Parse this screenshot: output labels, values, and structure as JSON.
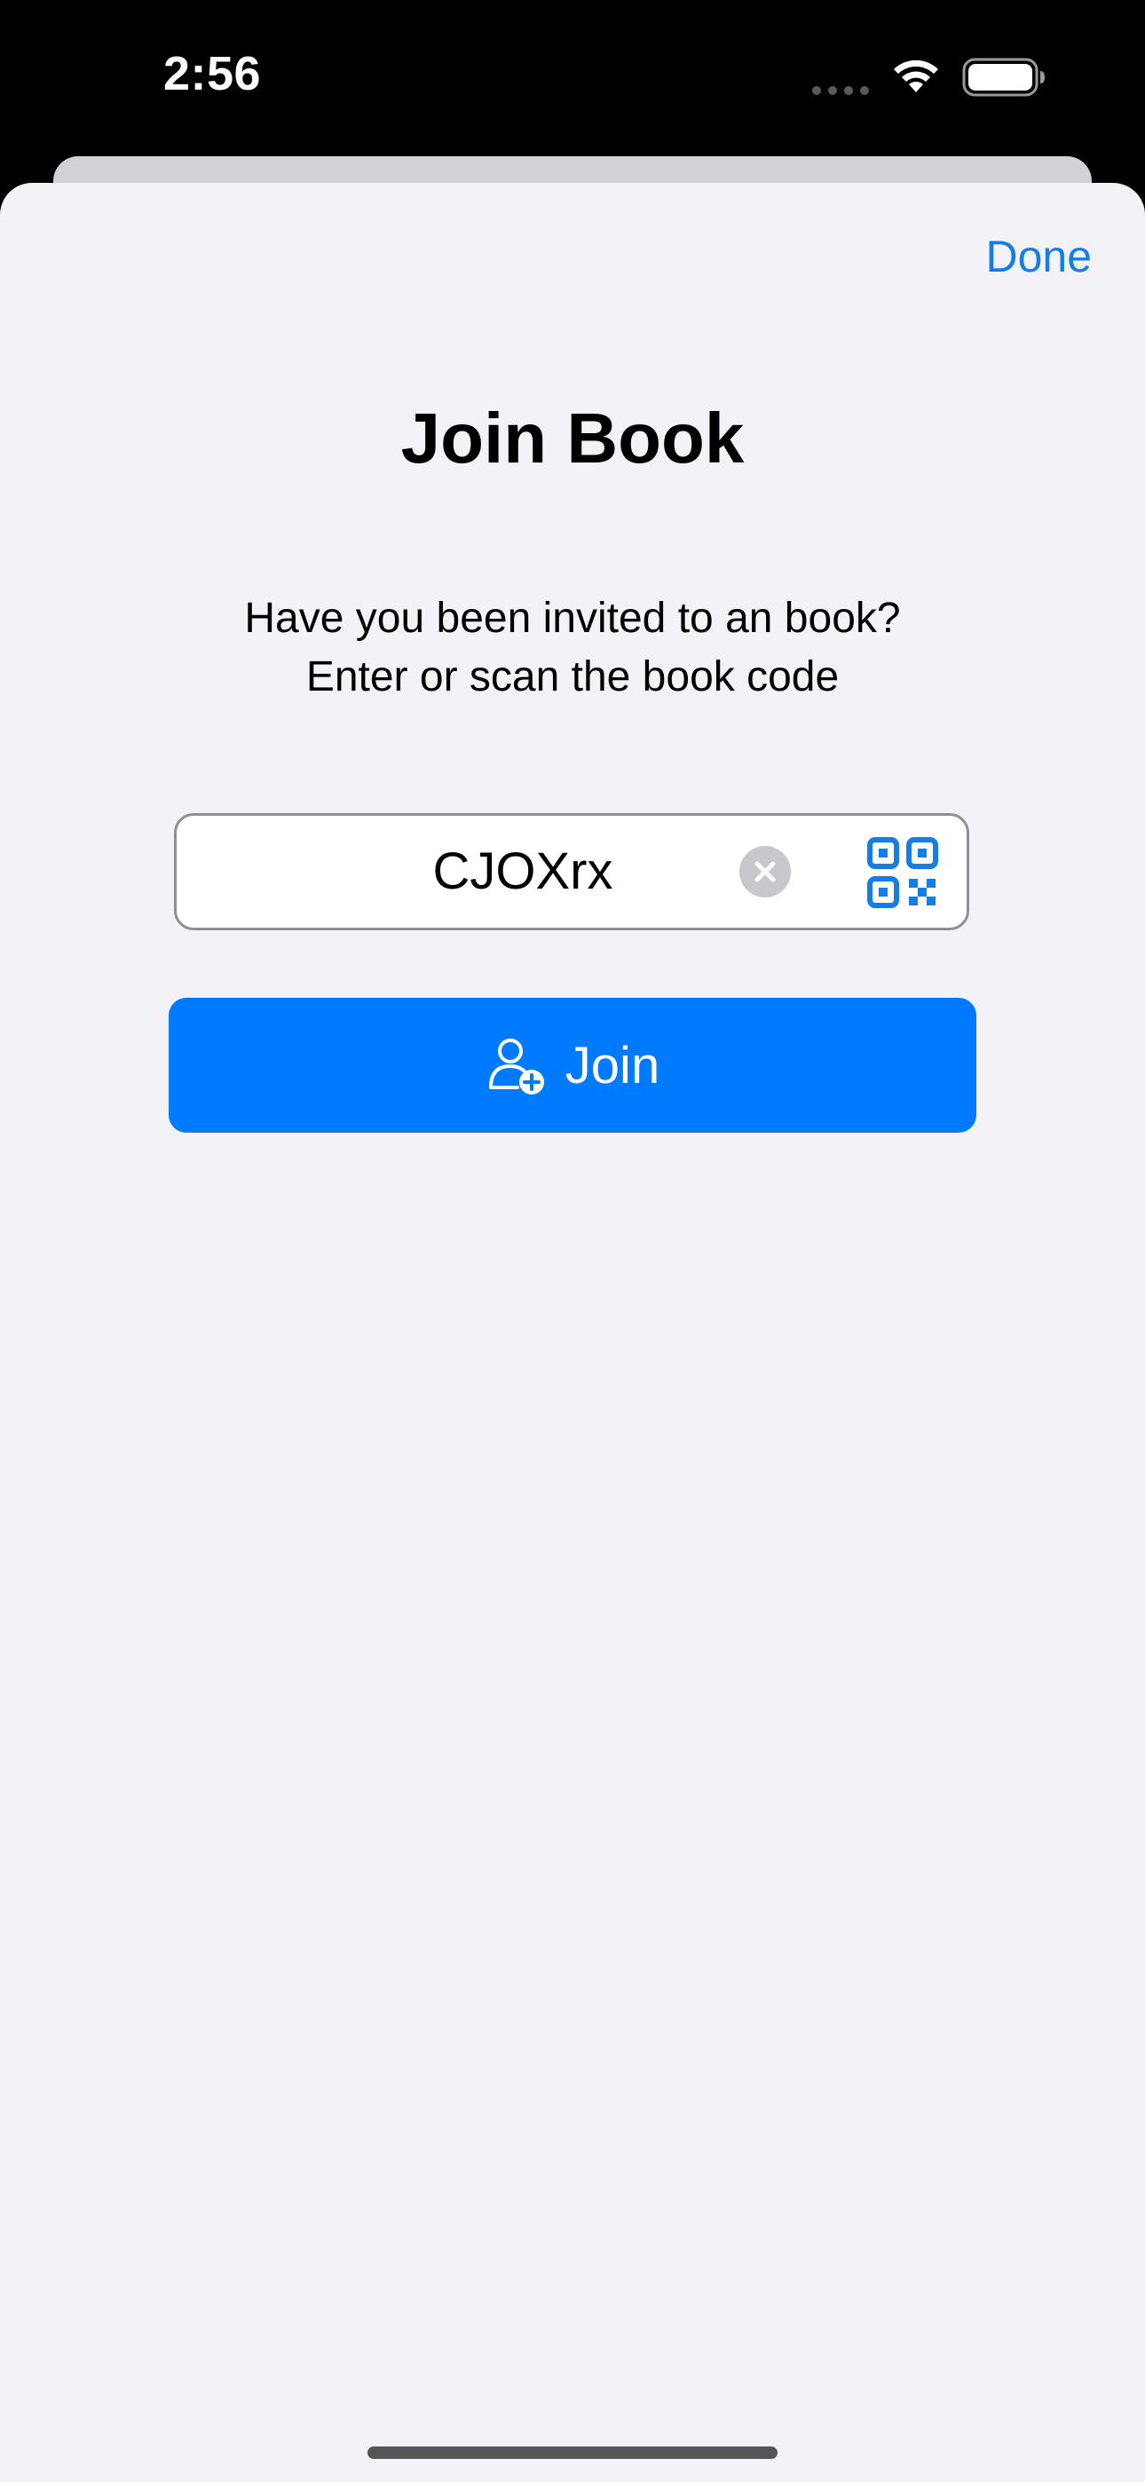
{
  "status_bar": {
    "time": "2:56",
    "icons": [
      "cellular-signal-icon",
      "wifi-icon",
      "battery-icon"
    ]
  },
  "sheet": {
    "done_label": "Done",
    "title": "Join Book",
    "subtitle_line1": "Have you been invited to an book?",
    "subtitle_line2": "Enter or scan the book code",
    "code_field": {
      "value": "CJOXrx",
      "clear_icon": "clear-circle-icon",
      "scan_icon": "qr-code-icon"
    },
    "join_button": {
      "label": "Join",
      "icon": "person-add-icon"
    }
  },
  "colors": {
    "accent": "#007aff",
    "link": "#147ee6",
    "background": "#f2f2f7",
    "field_border": "#8e8e93"
  }
}
